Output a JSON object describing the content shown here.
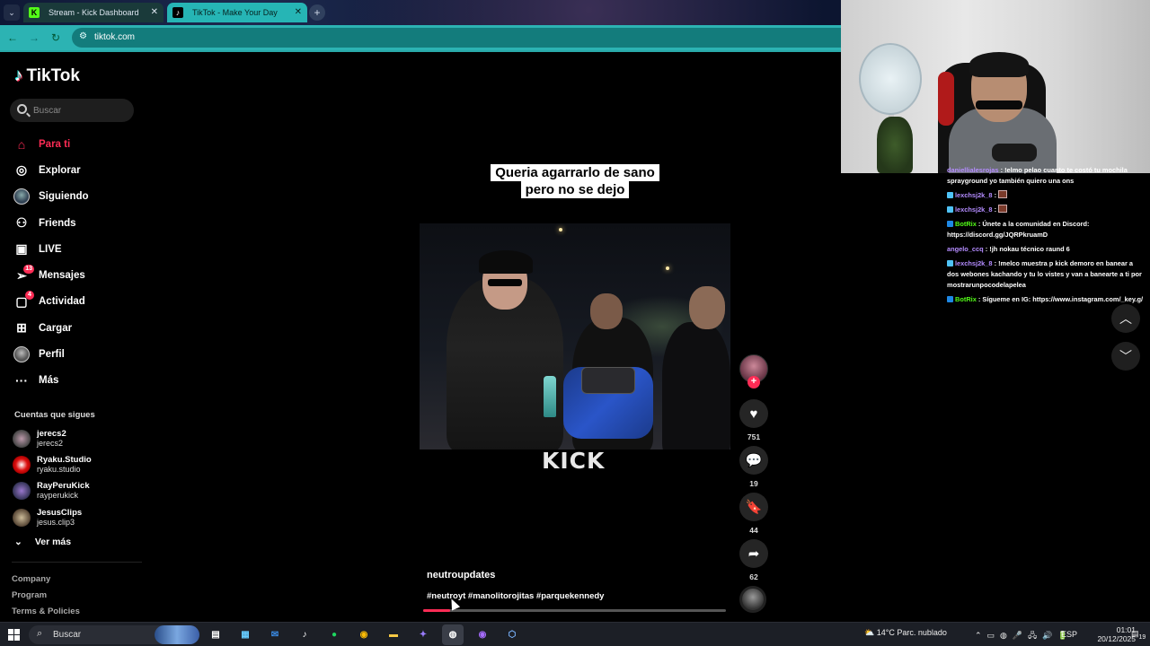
{
  "browser": {
    "tabs": [
      {
        "title": "Stream - Kick Dashboard",
        "favicon": "kick-icon"
      },
      {
        "title": "TikTok - Make Your Day",
        "favicon": "tiktok-icon",
        "active": true
      }
    ],
    "url": "tiktok.com"
  },
  "tiktok": {
    "logo": "TikTok",
    "search_placeholder": "Buscar",
    "nav": [
      {
        "label": "Para ti",
        "icon": "home-icon",
        "active": true
      },
      {
        "label": "Explorar",
        "icon": "compass-icon"
      },
      {
        "label": "Siguiendo",
        "icon": "following-avatar-icon"
      },
      {
        "label": "Friends",
        "icon": "friends-icon"
      },
      {
        "label": "LIVE",
        "icon": "live-icon"
      },
      {
        "label": "Mensajes",
        "icon": "messages-icon",
        "badge": "13"
      },
      {
        "label": "Actividad",
        "icon": "activity-icon",
        "badge": "4"
      },
      {
        "label": "Cargar",
        "icon": "upload-icon"
      },
      {
        "label": "Perfil",
        "icon": "profile-icon"
      },
      {
        "label": "Más",
        "icon": "more-icon"
      }
    ],
    "following_title": "Cuentas que sigues",
    "following": [
      {
        "name": "jerecs2",
        "handle": "jerecs2"
      },
      {
        "name": "Ryaku.Studio",
        "handle": "ryaku.studio"
      },
      {
        "name": "RayPeruKick",
        "handle": "rayperukick"
      },
      {
        "name": "JesusClips",
        "handle": "jesus.clip3"
      }
    ],
    "see_more": "Ver más",
    "footer": [
      "Company",
      "Program",
      "Terms & Policies"
    ],
    "video": {
      "caption_line1": "Queria agarrarlo de sano",
      "caption_line2": "pero no se dejo",
      "watermark": "KICK",
      "author": "neutroupdates",
      "hashtags": "#neutroyt #manolitorojitas #parquekennedy",
      "progress": 0.09,
      "likes": "751",
      "comments": "19",
      "saves": "44",
      "shares": "62"
    }
  },
  "chat": [
    {
      "user": "daniellialesrojas",
      "user_color": "#b48cff",
      "text": "!elmo pelao cuanto te costó tu mochila sprayground yo también quiero una ons",
      "badge": ""
    },
    {
      "user": "lexchsj2k_8",
      "user_color": "#b48cff",
      "text": "",
      "badge": "#4fc3f7",
      "emote": true
    },
    {
      "user": "lexchsj2k_8",
      "user_color": "#b48cff",
      "text": "",
      "badge": "#4fc3f7",
      "emote": true
    },
    {
      "user": "BotRix",
      "user_color": "#53fc18",
      "text": "Únete a la comunidad en Discord: https://discord.gg/JQRPkruamD",
      "badge": "#1e88e5"
    },
    {
      "user": "angelo_ccq",
      "user_color": "#b48cff",
      "text": "!jh nokau técnico raund 6",
      "badge": ""
    },
    {
      "user": "lexchsj2k_8",
      "user_color": "#b48cff",
      "text": "!melco muestra p kick demoro en banear a dos webones kachando y tu lo vistes y van a banearte a ti por mostrarunpocodelapelea",
      "badge": "#4fc3f7"
    },
    {
      "user": "BotRix",
      "user_color": "#53fc18",
      "text": "Sígueme en IG: https://www.instagram.com/_key.g/",
      "badge": "#1e88e5"
    }
  ],
  "taskbar": {
    "search_label": "Buscar",
    "apps": [
      "task-view",
      "microsoft-store",
      "outlook",
      "tiktok",
      "spotify",
      "chrome",
      "file-explorer",
      "copilot",
      "obs",
      "chrome-profile",
      "app"
    ],
    "weather": "14°C  Parc. nublado",
    "lang": "ESP",
    "time": "01:01",
    "date": "20/12/2025",
    "notifications": "19"
  },
  "colors": {
    "accent": "#fe2c55",
    "kick_green": "#53fc18",
    "browser_teal": "#2cb3b3"
  }
}
